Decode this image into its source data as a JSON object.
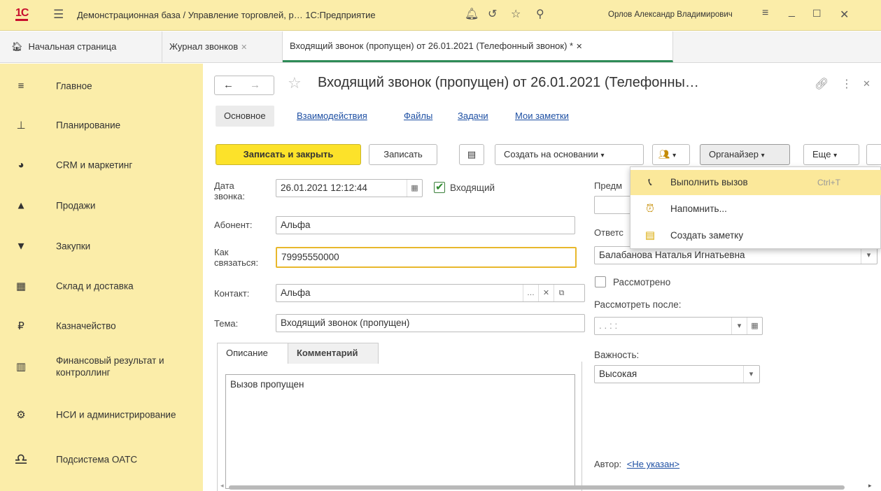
{
  "window": {
    "app_title": "Демонстрационная база / Управление торговлей, р…  1С:Предприятие",
    "user": "Орлов Александр Владимирович"
  },
  "tabs": [
    {
      "label": "Начальная страница"
    },
    {
      "label": "Журнал звонков"
    },
    {
      "label": "Входящий звонок (пропущен) от 26.01.2021 (Телефонный звонок) *"
    }
  ],
  "sidebar": {
    "items": [
      {
        "label": "Главное",
        "icon": "menu-icon"
      },
      {
        "label": "Планирование",
        "icon": "planning-icon"
      },
      {
        "label": "CRM и маркетинг",
        "icon": "pie-chart-icon"
      },
      {
        "label": "Продажи",
        "icon": "bag-icon"
      },
      {
        "label": "Закупки",
        "icon": "cart-icon"
      },
      {
        "label": "Склад и доставка",
        "icon": "warehouse-icon"
      },
      {
        "label": "Казначейство",
        "icon": "ruble-icon"
      },
      {
        "label": "Финансовый результат и контроллинг",
        "icon": "bar-chart-icon"
      },
      {
        "label": "НСИ и администрирование",
        "icon": "gear-icon"
      },
      {
        "label": "Подсистема ОАТС",
        "icon": "headset-icon"
      }
    ]
  },
  "form": {
    "title": "Входящий звонок (пропущен) от 26.01.2021 (Телефонны…",
    "tabs": [
      "Основное",
      "Взаимодействия",
      "Файлы",
      "Задачи",
      "Мои заметки"
    ],
    "toolbar": {
      "save_close": "Записать и закрыть",
      "save": "Записать",
      "create_based": "Создать на основании",
      "organizer": "Органайзер",
      "more": "Еще"
    },
    "fields": {
      "date_label": "Дата звонка:",
      "date_value": "26.01.2021 12:12:44",
      "incoming_label": "Входящий",
      "subscriber_label": "Абонент:",
      "subscriber_value": "Альфа",
      "how_label": "Как связаться:",
      "how_value": "79995550000",
      "contact_label": "Контакт:",
      "contact_value": "Альфа",
      "subject_label": "Тема:",
      "subject_value": "Входящий звонок (пропущен)",
      "predmet_label": "Предм",
      "responsible_label": "Ответс",
      "responsible_value": "Балабанова Наталья Игнатьевна",
      "reviewed_label": "Рассмотрено",
      "review_after_label": "Рассмотреть после:",
      "review_after_value": ".  .     :  :",
      "importance_label": "Важность:",
      "importance_value": "Высокая",
      "author_label": "Автор:",
      "author_value": "<Не указан>"
    },
    "desc_tabs": [
      "Описание",
      "Комментарий"
    ],
    "description": "Вызов пропущен"
  },
  "popup_menu": {
    "items": [
      {
        "label": "Выполнить вызов",
        "shortcut": "Ctrl+T",
        "icon": "phone-icon"
      },
      {
        "label": "Напомнить...",
        "shortcut": "",
        "icon": "reminder-icon"
      },
      {
        "label": "Создать заметку",
        "shortcut": "",
        "icon": "note-icon"
      }
    ]
  }
}
